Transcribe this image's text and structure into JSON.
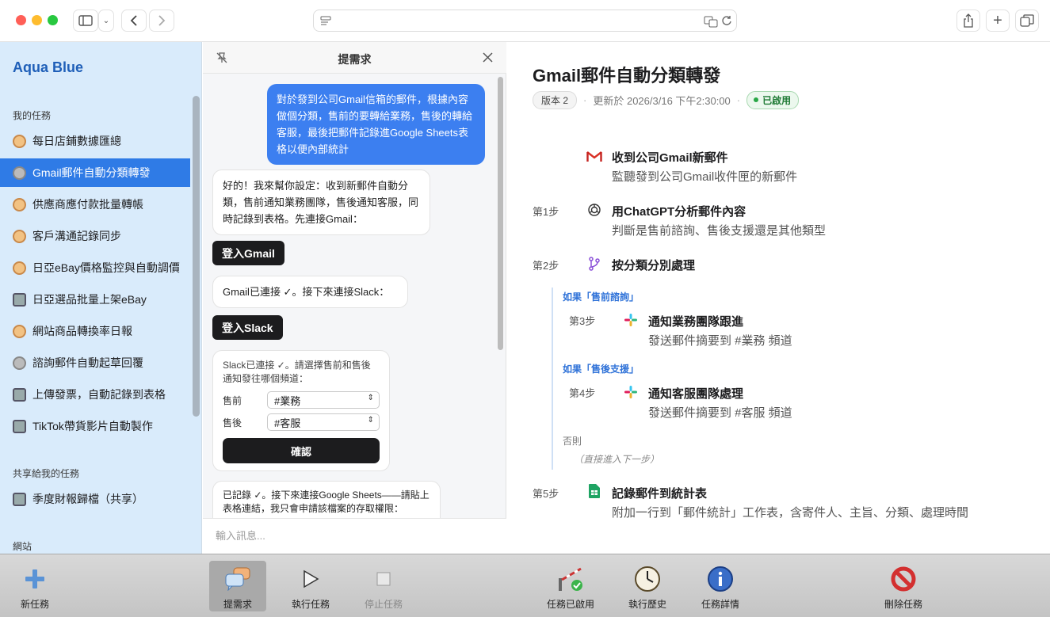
{
  "sidebar": {
    "brand": "Aqua Blue",
    "my_tasks_header": "我的任務",
    "shared_header": "共享給我的任務",
    "site_header": "網站",
    "items": [
      {
        "label": "每日店鋪數據匯總",
        "icon": "clock-icon"
      },
      {
        "label": "Gmail郵件自動分類轉發",
        "icon": "gear-icon"
      },
      {
        "label": "供應商應付款批量轉帳",
        "icon": "clock-icon"
      },
      {
        "label": "客戶溝通記錄同步",
        "icon": "clock-icon"
      },
      {
        "label": "日亞eBay價格監控與自動調價",
        "icon": "clock-icon"
      },
      {
        "label": "日亞選品批量上架eBay",
        "icon": "robot-icon"
      },
      {
        "label": "網站商品轉換率日報",
        "icon": "clock-icon"
      },
      {
        "label": "諮詢郵件自動起草回覆",
        "icon": "gear-icon"
      },
      {
        "label": "上傳發票，自動記錄到表格",
        "icon": "robot-icon"
      },
      {
        "label": "TikTok帶貨影片自動製作",
        "icon": "robot-icon"
      }
    ],
    "shared_items": [
      {
        "label": "季度財報歸檔（共享）",
        "icon": "robot-icon"
      }
    ]
  },
  "chat": {
    "title": "提需求",
    "user_msg": "對於發到公司Gmail信箱的郵件，根據內容做個分類，售前的要轉給業務，售後的轉給客服，最後把郵件記錄進Google Sheets表格以便內部統計",
    "bot_msg1": "好的！我來幫你設定：收到新郵件自動分類，售前通知業務團隊，售後通知客服，同時記錄到表格。先連接Gmail：",
    "login_gmail": "登入Gmail",
    "bot_msg2": "Gmail已連接 ✓。接下來連接Slack：",
    "login_slack": "登入Slack",
    "form_text": "Slack已連接 ✓。請選擇售前和售後通知發往哪個頻道：",
    "presale_label": "售前",
    "presale_value": "#業務",
    "aftersale_label": "售後",
    "aftersale_value": "#客服",
    "confirm": "確認",
    "bot_msg3": "已記錄 ✓。接下來連接Google Sheets——請貼上表格連結，我只會申請該檔案的存取權限：",
    "input_placeholder": "輸入訊息..."
  },
  "main": {
    "title": "Gmail郵件自動分類轉發",
    "version": "版本 2",
    "updated": "更新於 2026/3/16 下午2:30:00",
    "status": "已啟用",
    "trigger": {
      "title": "收到公司Gmail新郵件",
      "desc": "監聽發到公司Gmail收件匣的新郵件"
    },
    "step1": {
      "label": "第1步",
      "title": "用ChatGPT分析郵件內容",
      "desc": "判斷是售前諮詢、售後支援還是其他類型"
    },
    "step2": {
      "label": "第2步",
      "title": "按分類分別處理"
    },
    "cond1": "如果「售前諮詢」",
    "step3": {
      "label": "第3步",
      "title": "通知業務團隊跟進",
      "desc": "發送郵件摘要到 #業務 頻道"
    },
    "cond2": "如果「售後支援」",
    "step4": {
      "label": "第4步",
      "title": "通知客服團隊處理",
      "desc": "發送郵件摘要到 #客服 頻道"
    },
    "else": "否則",
    "passthrough": "（直接進入下一步）",
    "step5": {
      "label": "第5步",
      "title": "記錄郵件到統計表",
      "desc": "附加一行到「郵件統計」工作表，含寄件人、主旨、分類、處理時間"
    }
  },
  "toolbar": {
    "new_task": "新任務",
    "request": "提需求",
    "run": "執行任務",
    "stop": "停止任務",
    "enabled": "任務已啟用",
    "history": "執行歷史",
    "details": "任務詳情",
    "delete": "刪除任務"
  }
}
